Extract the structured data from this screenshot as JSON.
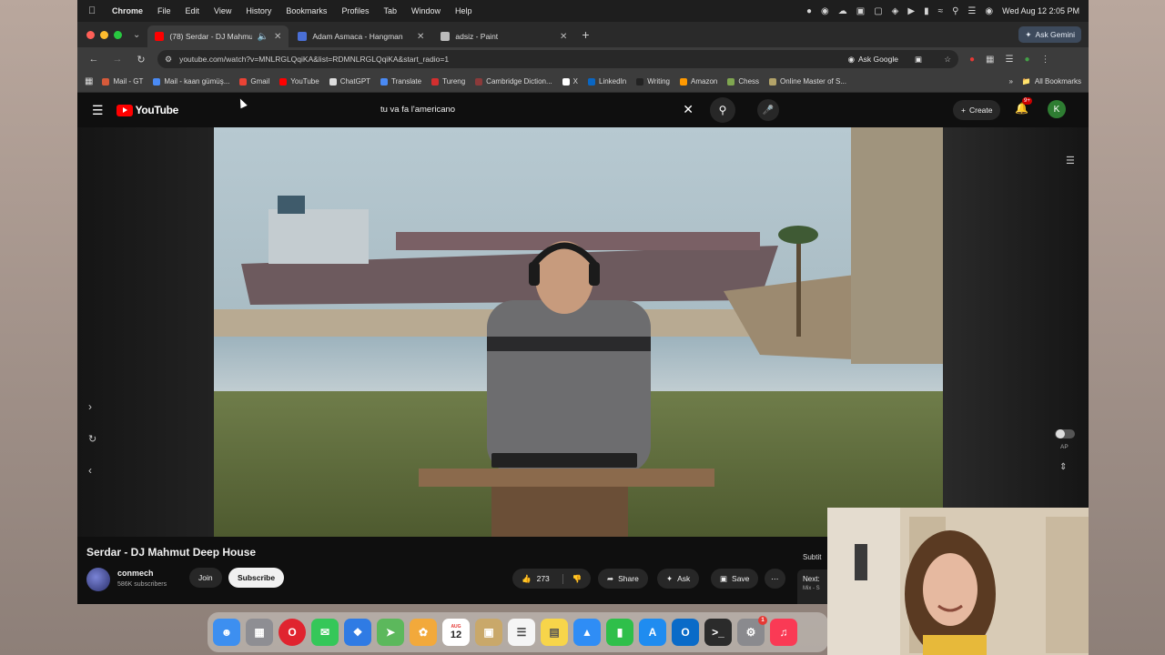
{
  "menubar": {
    "app": "Chrome",
    "items": [
      "File",
      "Edit",
      "View",
      "History",
      "Bookmarks",
      "Profiles",
      "Tab",
      "Window",
      "Help"
    ],
    "clock": "Wed Aug 12  2:05 PM"
  },
  "tabs": [
    {
      "title": "(78) Serdar - DJ Mahmut",
      "active": true,
      "favicon_color": "#ff0000",
      "audio": true
    },
    {
      "title": "Adam Asmaca - Hangman",
      "active": false,
      "favicon_color": "#4a6fd6"
    },
    {
      "title": "adsiz - Paint",
      "active": false,
      "favicon_color": "#bbbbbb"
    }
  ],
  "gemini_label": "Ask Gemini",
  "address": {
    "url": "youtube.com/watch?v=MNLRGLQqiKA&list=RDMNLRGLQqiKA&start_radio=1",
    "ask_google": "Ask Google"
  },
  "bookmarks": {
    "items": [
      {
        "label": "Mail - GT",
        "color": "#d65a3a"
      },
      {
        "label": "Mail - kaan gümüş...",
        "color": "#4a8af4"
      },
      {
        "label": "Gmail",
        "color": "#ea4335"
      },
      {
        "label": "YouTube",
        "color": "#ff0000"
      },
      {
        "label": "ChatGPT",
        "color": "#dddddd"
      },
      {
        "label": "Translate",
        "color": "#4a8af4"
      },
      {
        "label": "Tureng",
        "color": "#d32f2f"
      },
      {
        "label": "Cambridge Diction...",
        "color": "#8b3a3a"
      },
      {
        "label": "X",
        "color": "#ffffff"
      },
      {
        "label": "LinkedIn",
        "color": "#0a66c2"
      },
      {
        "label": "Writing",
        "color": "#222222"
      },
      {
        "label": "Amazon",
        "color": "#ff9900"
      },
      {
        "label": "Chess",
        "color": "#7fa650"
      },
      {
        "label": "Online Master of S...",
        "color": "#b3a369"
      }
    ],
    "all_bookmarks": "All Bookmarks"
  },
  "youtube": {
    "logo_text": "YouTube",
    "search_query": "tu va fa l'americano",
    "create_label": "Create",
    "notif_count": "9+",
    "avatar_letter": "K",
    "video_title": "Serdar - DJ Mahmut Deep House",
    "channel_name": "conmech",
    "channel_subs": "586K subscribers",
    "join_label": "Join",
    "subscribe_label": "Subscribe",
    "like_count": "273",
    "share_label": "Share",
    "ask_label": "Ask",
    "save_label": "Save",
    "autoplay_label": "AP",
    "subtitle_text": "Subtit",
    "next_text": "Next:",
    "next_sub": "Mix - S"
  },
  "dock": {
    "apps": [
      {
        "name": "Finder",
        "color": "#3d8ff0"
      },
      {
        "name": "Launchpad",
        "color": "#8e8e93"
      },
      {
        "name": "Opera",
        "color": "#e0242f"
      },
      {
        "name": "Messages",
        "color": "#35c759"
      },
      {
        "name": "Safari",
        "color": "#2f7be4"
      },
      {
        "name": "Maps",
        "color": "#5cb85c"
      },
      {
        "name": "Photos",
        "color": "#f2a93b"
      },
      {
        "name": "Calendar",
        "color": "#ffffff",
        "label": "12",
        "month": "AUG"
      },
      {
        "name": "Archive",
        "color": "#c9a86a"
      },
      {
        "name": "Reminders",
        "color": "#f5f5f5"
      },
      {
        "name": "Notes",
        "color": "#f7d54a"
      },
      {
        "name": "Keynote",
        "color": "#2f8df5"
      },
      {
        "name": "Numbers",
        "color": "#2fbf4a"
      },
      {
        "name": "App Store",
        "color": "#1f8cf0"
      },
      {
        "name": "Outlook",
        "color": "#0a6bc8"
      },
      {
        "name": "Terminal",
        "color": "#2b2b2b"
      },
      {
        "name": "System Settings",
        "color": "#8a8a8e",
        "badge": "1"
      },
      {
        "name": "Music",
        "color": "#fa3a55"
      }
    ]
  }
}
